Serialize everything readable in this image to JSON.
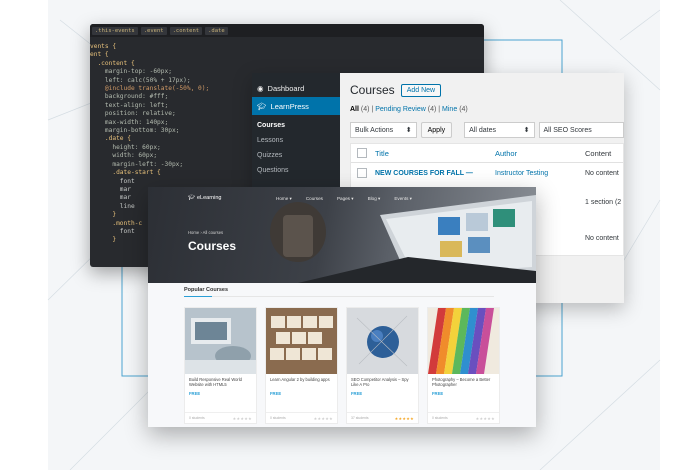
{
  "editor": {
    "tabs": [
      ".this-events",
      ".event",
      ".content",
      ".date"
    ],
    "lines": [
      "vents {",
      "ent {",
      "  .content {",
      "    margin-top: -60px;",
      "    left: calc(50% + 17px);",
      "    @include translate(-50%, 0);",
      "    background: #fff;",
      "    text-align: left;",
      "    position: relative;",
      "    max-width: 140px;",
      "    margin-bottom: 30px;",
      "    .date {",
      "      height: 60px;",
      "      width: 60px;",
      "      margin-left: -30px;",
      "",
      "      .date-start {",
      "        font",
      "        mar",
      "        mar",
      "        line",
      "      }",
      "      .month-c",
      "        font",
      "      }"
    ]
  },
  "wp": {
    "sidebar": {
      "dashboard": "Dashboard",
      "learnpress": "LearnPress",
      "items": [
        "Courses",
        "Lessons",
        "Quizzes",
        "Questions"
      ]
    },
    "title": "Courses",
    "add_new": "Add New",
    "filters": {
      "all": "All",
      "all_count": "(4)",
      "pending": "Pending Review",
      "pending_count": "(4)",
      "mine": "Mine",
      "mine_count": "(4)",
      "sep": "|"
    },
    "bulk_actions": "Bulk Actions",
    "apply": "Apply",
    "all_dates": "All dates",
    "seo": "All SEO Scores",
    "columns": {
      "title": "Title",
      "author": "Author",
      "content": "Content"
    },
    "rows": [
      {
        "title": "NEW COURSES FOR FALL —",
        "author": "Instructor Testing",
        "content": "No content"
      },
      {
        "title": "",
        "author": "esting",
        "content": "1 section (2"
      },
      {
        "title": "",
        "author": "esting",
        "content": "No content"
      }
    ]
  },
  "site": {
    "logo": "eLearning",
    "nav": [
      "Home ▾",
      "Courses",
      "Pages ▾",
      "Blog ▾",
      "Events ▾"
    ],
    "breadcrumb": "Home  ›  All courses",
    "hero_title": "Courses",
    "section_title": "Popular Courses",
    "accent": "#2a9fd6",
    "courses": [
      {
        "title": "Build Responsive Real World Website with HTML5",
        "price": "FREE",
        "students": "0 students",
        "rating": 0
      },
      {
        "title": "Learn Angular 2 by building apps",
        "price": "FREE",
        "students": "0 students",
        "rating": 0
      },
      {
        "title": "SEO Competitor Analysis – Spy Like A Pro",
        "price": "FREE",
        "students": "37 students",
        "rating": 5
      },
      {
        "title": "Photography – Become a Better Photographer",
        "price": "FREE",
        "students": "0 students",
        "rating": 0
      }
    ]
  }
}
